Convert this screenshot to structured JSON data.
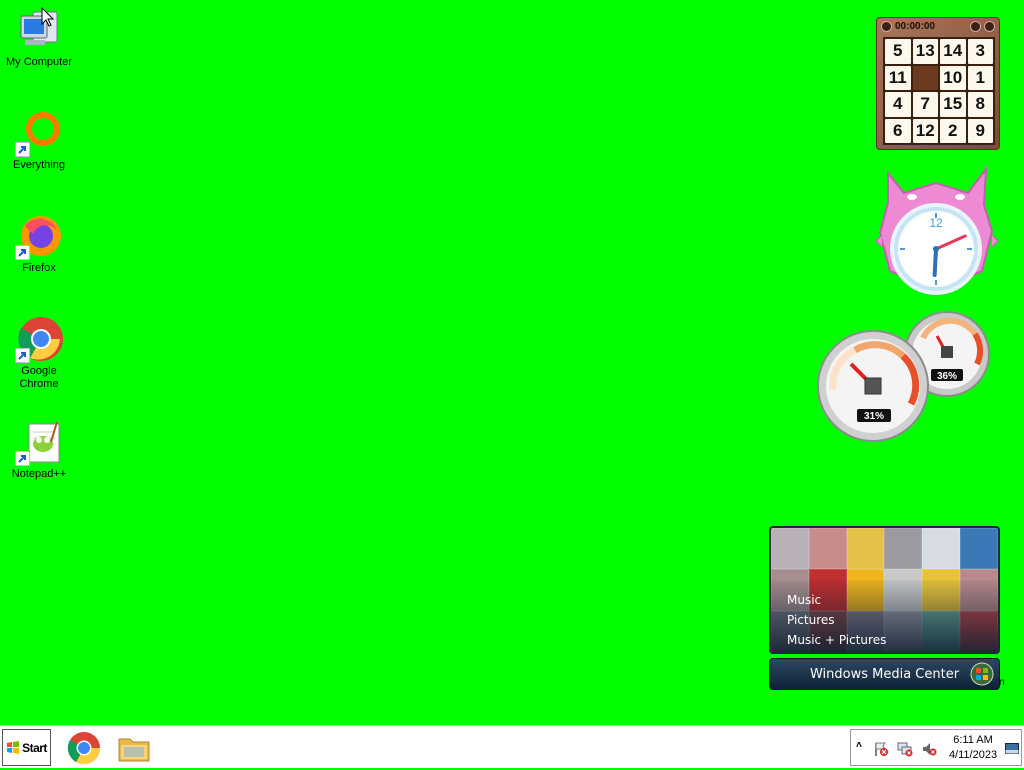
{
  "desktop": {
    "background_color": "#00ff00",
    "icons": [
      {
        "label": "My Computer",
        "icon": "computer-icon"
      },
      {
        "label": "Everything",
        "icon": "everything-icon"
      },
      {
        "label": "Firefox",
        "icon": "firefox-icon"
      },
      {
        "label": "Google Chrome",
        "icon": "chrome-icon"
      },
      {
        "label": "Notepad++",
        "icon": "notepad-plus-plus-icon"
      }
    ]
  },
  "puzzle_gadget": {
    "timer": "00:00:00",
    "tiles": [
      "5",
      "13",
      "14",
      "3",
      "11",
      "",
      "10",
      "1",
      "4",
      "7",
      "15",
      "8",
      "6",
      "12",
      "2",
      "9"
    ]
  },
  "clock_gadget": {
    "twelve": "12",
    "hour_hand_angle_deg": 183,
    "minute_hand_angle_deg": 66
  },
  "cpu_gadget": {
    "cpu_percent": "31%",
    "memory_percent": "36%"
  },
  "media_center": {
    "menu": [
      "Music",
      "Pictures",
      "Music + Pictures"
    ],
    "title": "Windows Media Center",
    "stray_char": "n"
  },
  "taskbar": {
    "start_label": "Start",
    "apps": [
      {
        "name": "Google Chrome",
        "icon": "chrome-icon"
      },
      {
        "name": "File Explorer",
        "icon": "folder-icon"
      }
    ],
    "tray": {
      "expand": "˄",
      "icons": [
        "action-center-alert-icon",
        "network-disconnected-icon",
        "volume-muted-icon"
      ],
      "time": "6:11 AM",
      "date": "4/11/2023"
    }
  }
}
